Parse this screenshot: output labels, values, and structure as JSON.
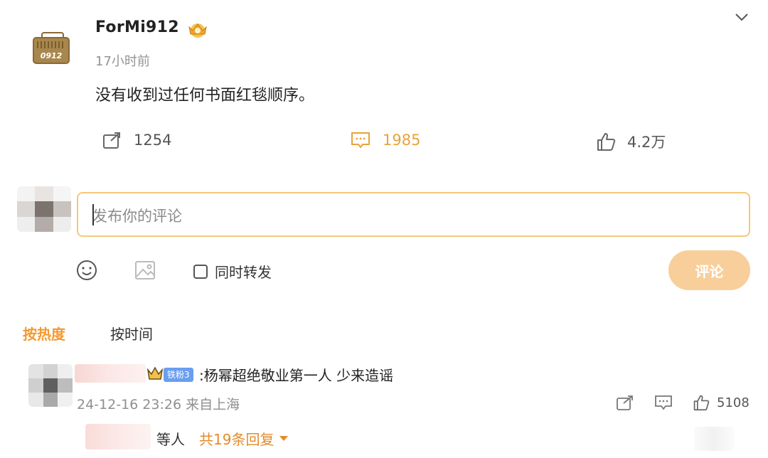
{
  "post": {
    "username": "ForMi912",
    "avatar_label": "0912",
    "time": "17小时前",
    "text": "没有收到过任何书面红毯顺序。",
    "repost_count": "1254",
    "comment_count": "1985",
    "like_count": "4.2万"
  },
  "composer": {
    "placeholder": "发布你的评论",
    "repost_label": "同时转发",
    "submit_label": "评论"
  },
  "sort": {
    "hot_label": "按热度",
    "time_label": "按时间"
  },
  "comments": [
    {
      "fan_badge": "铁粉3",
      "text": ":杨幂超绝敬业第一人 少来造谣",
      "meta": "24-12-16 23:26 来自上海",
      "like_count": "5108",
      "reply_prefix": "等人",
      "reply_count_label": "共19条回复"
    }
  ],
  "colors": {
    "accent": "#f39a2e",
    "comment_active": "#e8a33a",
    "submit_bg": "#f8cf9a",
    "input_border": "#f5c87a"
  }
}
